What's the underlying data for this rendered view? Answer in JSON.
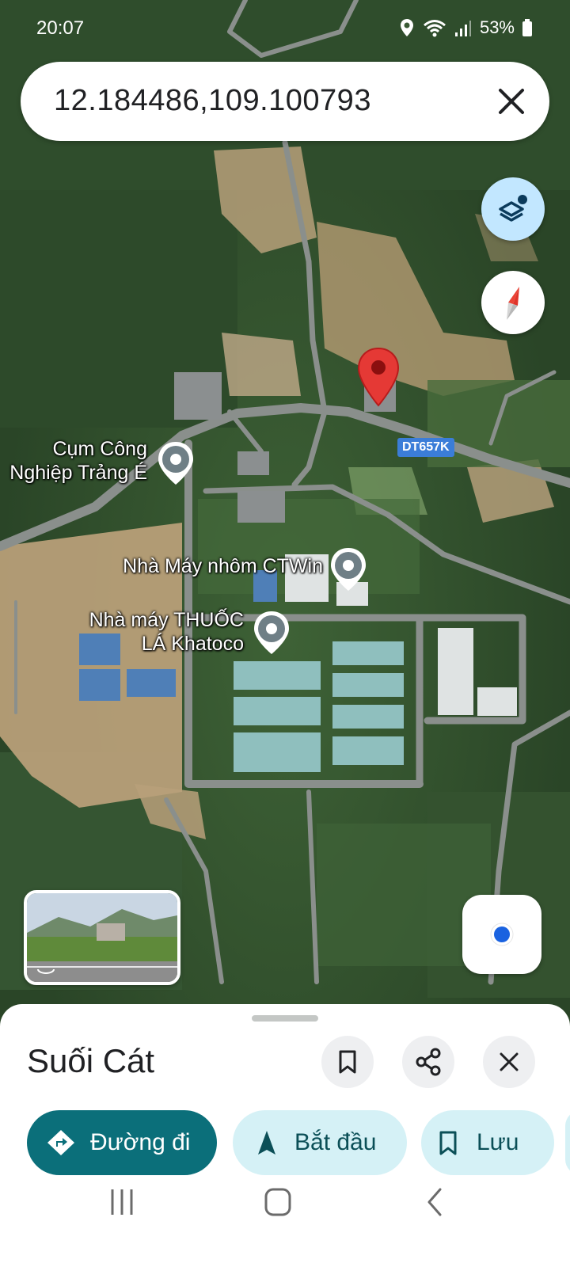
{
  "status_bar": {
    "time": "20:07",
    "battery": "53%"
  },
  "search": {
    "query": "12.184486,109.100793"
  },
  "map": {
    "road_shield": "DT657K",
    "poi_labels": [
      {
        "line1": "Cụm Công",
        "line2": "Nghiệp Trảng É"
      },
      {
        "line1": "Nhà Máy nhôm CTWin",
        "line2": ""
      },
      {
        "line1": "Nhà máy THUỐC",
        "line2": "LÁ Khatoco"
      }
    ],
    "icons": [
      "layers-icon",
      "compass-icon",
      "my-location-icon",
      "red-location-pin",
      "poi-pin"
    ]
  },
  "place": {
    "name": "Suối Cát"
  },
  "actions": {
    "directions": "Đường đi",
    "start": "Bắt đầu",
    "save": "Lưu"
  },
  "colors": {
    "primary": "#0b6f7a",
    "chip": "#d5f1f6",
    "pin": "#d93025",
    "layers": "#c2e7ff"
  }
}
